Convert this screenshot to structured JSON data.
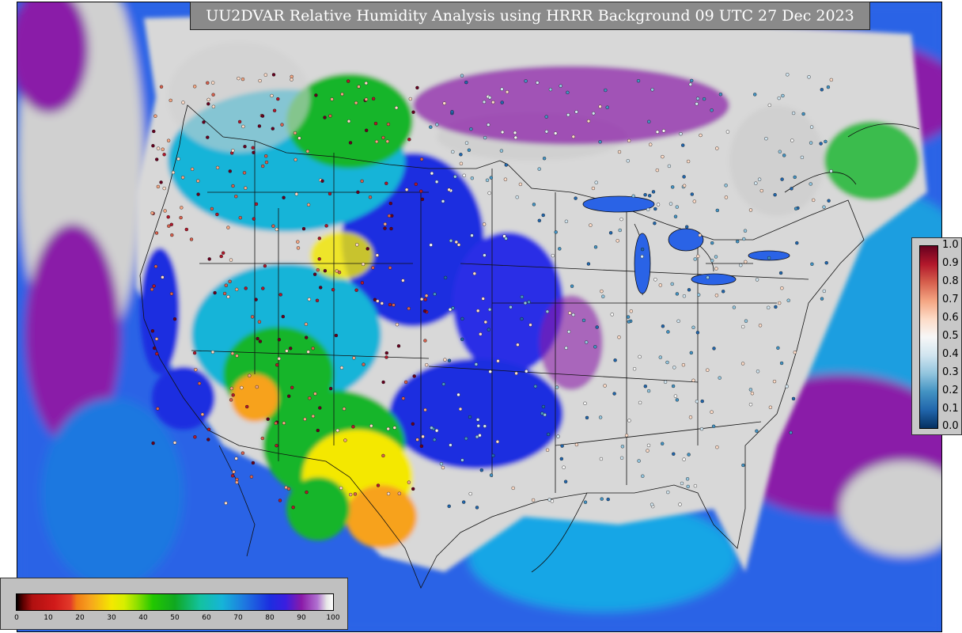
{
  "title": "UU2DVAR Relative Humidity Analysis using HRRR Background 09 UTC 27 Dec 2023",
  "map": {
    "region": "CONUS",
    "field": "relative humidity",
    "colors": {
      "ocean": "#2a63e6",
      "saturated": "#d0d0d0",
      "very_moist": "#8a1aa8",
      "moist": "#1c2ee0",
      "mid": "#17b4d8",
      "green": "#13b52a",
      "yellow": "#f4e800",
      "orange": "#f7a21e",
      "dry": "#c01a1a",
      "border": "#111111"
    }
  },
  "obs_legend": {
    "ticks": [
      "1.0",
      "0.9",
      "0.8",
      "0.7",
      "0.6",
      "0.5",
      "0.4",
      "0.3",
      "0.2",
      "0.1",
      "0.0"
    ],
    "colors": [
      "#67001f",
      "#b2182b",
      "#d6604d",
      "#f4a582",
      "#fddbc7",
      "#f7f7f7",
      "#d1e5f0",
      "#92c5de",
      "#4393c3",
      "#2166ac",
      "#053061"
    ]
  },
  "rh_legend": {
    "ticks": [
      "0",
      "10",
      "20",
      "30",
      "40",
      "50",
      "60",
      "70",
      "80",
      "90",
      "100"
    ],
    "range": [
      0,
      100
    ]
  }
}
